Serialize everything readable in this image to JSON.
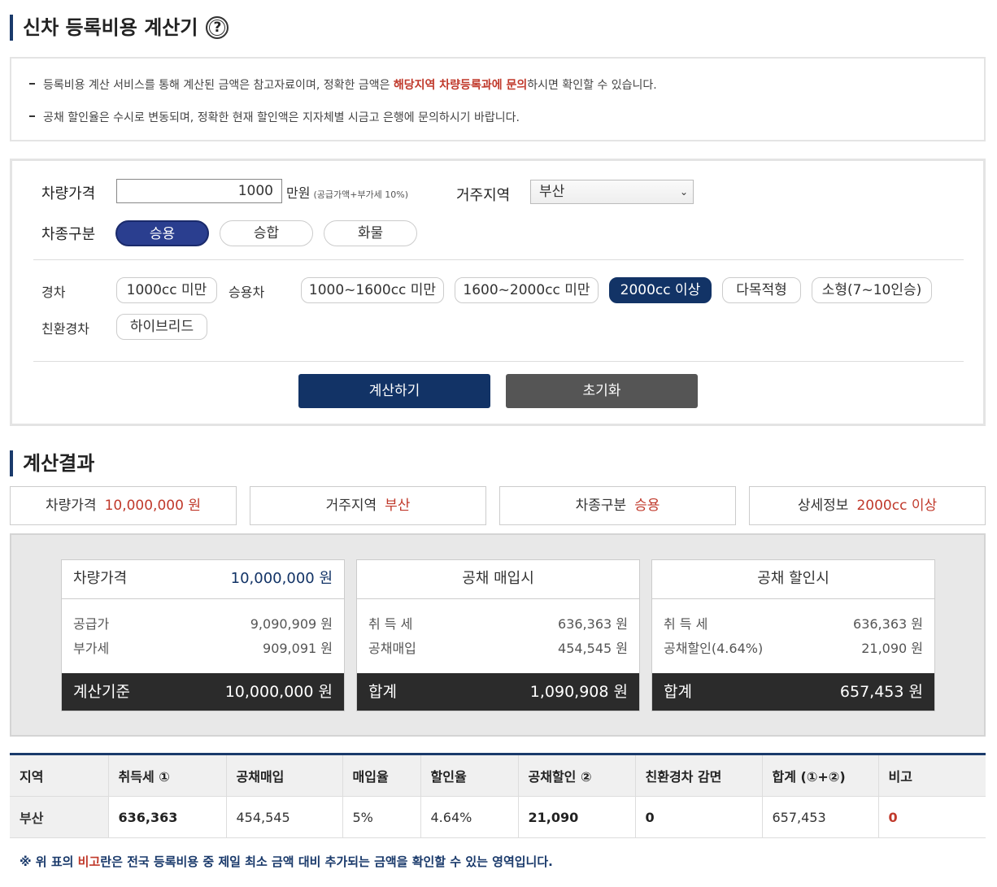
{
  "header": {
    "title": "신차 등록비용 계산기",
    "help_glyph": "?"
  },
  "notice": {
    "line1_pre": "등록비용 계산 서비스를 통해 계산된 금액은 참고자료이며, 정확한 금액은 ",
    "line1_red": "해당지역 차량등록과에 문의",
    "line1_post": "하시면 확인할 수 있습니다.",
    "line2": "공채 할인율은 수시로 변동되며, 정확한 현재 할인액은 지자체별 시금고 은행에 문의하시기 바랍니다."
  },
  "form": {
    "price_label": "차량가격",
    "price_value": "1000",
    "price_unit": "만원",
    "price_note": "(공급가액+부가세 10%)",
    "region_label": "거주지역",
    "region_value": "부산",
    "type_label": "차종구분",
    "types": [
      "승용",
      "승합",
      "화물"
    ],
    "type_selected": "승용",
    "compact_label": "경차",
    "compact_options": [
      "1000cc 미만"
    ],
    "passenger_label": "승용차",
    "passenger_options": [
      "1000~1600cc 미만",
      "1600~2000cc 미만",
      "2000cc 이상",
      "다목적형",
      "소형(7~10인승)"
    ],
    "passenger_selected": "2000cc 이상",
    "eco_label": "친환경차",
    "eco_options": [
      "하이브리드"
    ],
    "calc_button": "계산하기",
    "reset_button": "초기화"
  },
  "result": {
    "title": "계산결과",
    "summary": [
      {
        "label": "차량가격",
        "value": "10,000,000 원"
      },
      {
        "label": "거주지역",
        "value": "부산"
      },
      {
        "label": "차종구분",
        "value": "승용"
      },
      {
        "label": "상세정보",
        "value": "2000cc 이상"
      }
    ],
    "cards": {
      "price": {
        "label": "차량가격",
        "value": "10,000,000 원",
        "rows": [
          {
            "k": "공급가",
            "v": "9,090,909 원"
          },
          {
            "k": "부가세",
            "v": "909,091 원"
          }
        ],
        "foot_label": "계산기준",
        "foot_value": "10,000,000 원"
      },
      "purchase": {
        "title": "공채 매입시",
        "rows": [
          {
            "k": "취 득 세",
            "v": "636,363 원"
          },
          {
            "k": "공채매입",
            "v": "454,545 원"
          }
        ],
        "foot_label": "합계",
        "foot_value": "1,090,908 원"
      },
      "discount": {
        "title": "공채 할인시",
        "rows": [
          {
            "k": "취 득 세",
            "v": "636,363 원"
          },
          {
            "k": "공채할인(4.64%)",
            "v": "21,090 원"
          }
        ],
        "foot_label": "합계",
        "foot_value": "657,453 원"
      }
    },
    "table": {
      "headers": [
        "지역",
        "취득세 ①",
        "공채매입",
        "매입율",
        "할인율",
        "공채할인 ②",
        "친환경차 감면",
        "합계 (①+②)",
        "비고"
      ],
      "row": [
        "부산",
        "636,363",
        "454,545",
        "5%",
        "4.64%",
        "21,090",
        "0",
        "657,453",
        "0"
      ]
    },
    "footnote_pre": "※ 위 표의 ",
    "footnote_red": "비고",
    "footnote_post": "란은 전국 등록비용 중 제일 최소 금액 대비 추가되는 금액을 확인할 수 있는 영역입니다."
  },
  "colors": {
    "accent": "#1a3a6b",
    "selected": "#123366",
    "pill_on": "#2a3e8f",
    "highlight": "#c0392b"
  }
}
